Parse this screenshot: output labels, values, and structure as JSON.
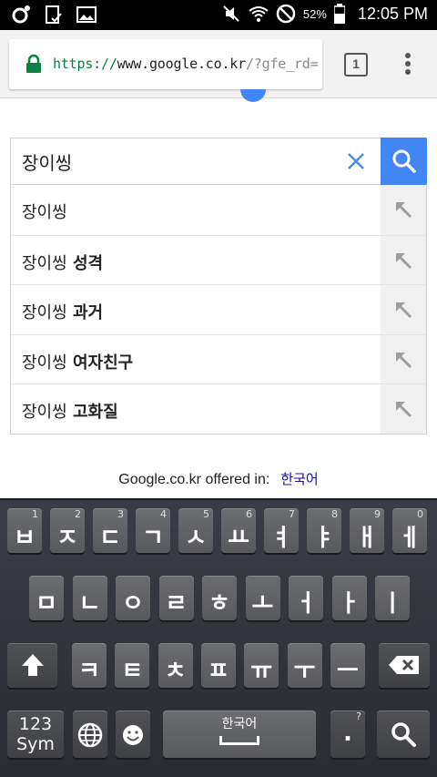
{
  "status_bar": {
    "battery_percent": "52%",
    "time": "12:05 PM"
  },
  "browser": {
    "url_scheme": "https://",
    "url_domain": "www.google.co.kr",
    "url_path": "/?gfe_rd=",
    "tab_count": "1"
  },
  "search": {
    "query": "장이씽"
  },
  "suggestions": [
    {
      "prefix": "장이씽",
      "suffix": ""
    },
    {
      "prefix": "장이씽",
      "suffix": " 성격"
    },
    {
      "prefix": "장이씽",
      "suffix": " 과거"
    },
    {
      "prefix": "장이씽",
      "suffix": " 여자친구"
    },
    {
      "prefix": "장이씽",
      "suffix": " 고화질"
    }
  ],
  "footer": {
    "offered_text": "Google.co.kr offered in:",
    "language_link": "한국어"
  },
  "keyboard": {
    "row1": [
      {
        "key": "ㅂ",
        "num": "1"
      },
      {
        "key": "ㅈ",
        "num": "2"
      },
      {
        "key": "ㄷ",
        "num": "3"
      },
      {
        "key": "ㄱ",
        "num": "4"
      },
      {
        "key": "ㅅ",
        "num": "5"
      },
      {
        "key": "ㅛ",
        "num": "6"
      },
      {
        "key": "ㅕ",
        "num": "7"
      },
      {
        "key": "ㅑ",
        "num": "8"
      },
      {
        "key": "ㅐ",
        "num": "9"
      },
      {
        "key": "ㅔ",
        "num": "0"
      }
    ],
    "row2": [
      "ㅁ",
      "ㄴ",
      "ㅇ",
      "ㄹ",
      "ㅎ",
      "ㅗ",
      "ㅓ",
      "ㅏ",
      "ㅣ"
    ],
    "row3": [
      "ㅋ",
      "ㅌ",
      "ㅊ",
      "ㅍ",
      "ㅠ",
      "ㅜ",
      "ㅡ"
    ],
    "sym_line1": "123",
    "sym_line2": "Sym",
    "space_label": "한국어",
    "period_label": ".",
    "period_hint": "?"
  }
}
